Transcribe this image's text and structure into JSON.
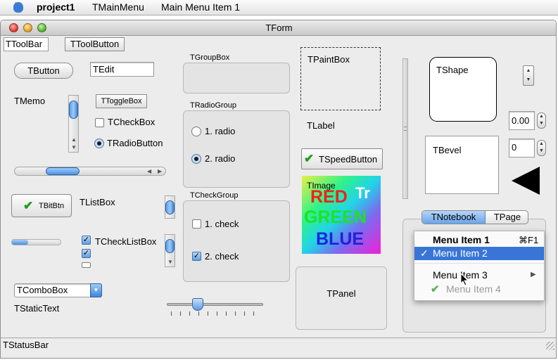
{
  "menubar": {
    "app": "project1",
    "items": [
      "TMainMenu",
      "Main Menu Item 1"
    ]
  },
  "window": {
    "title": "TForm"
  },
  "toolbar": {
    "label": "TToolBar",
    "button": "TToolButton"
  },
  "widgets": {
    "button": "TButton",
    "edit": "TEdit",
    "memo": "TMemo",
    "togglebox": "TToggleBox",
    "checkbox": "TCheckBox",
    "radiobutton": "TRadioButton",
    "bitbtn": "TBitBtn",
    "listbox": "TListBox",
    "checklistbox": "TCheckListBox",
    "combobox": "TComboBox",
    "statictext": "TStaticText",
    "groupbox": "TGroupBox",
    "radiogroup": {
      "caption": "TRadioGroup",
      "items": [
        "1. radio",
        "2. radio"
      ],
      "selected_index": 1
    },
    "checkgroup": {
      "caption": "TCheckGroup",
      "items": [
        "1. check",
        "2. check"
      ],
      "checked": [
        false,
        true
      ]
    },
    "paintbox": "TPaintBox",
    "label": "TLabel",
    "speedbutton": "TSpeedButton",
    "image": {
      "caption": "TImage",
      "red": "RED",
      "green": "GREEN",
      "blue": "BLUE",
      "logo": "Tr"
    },
    "panel": "TPanel",
    "shape": "TShape",
    "bevel": "TBevel",
    "spin_float": "0.00",
    "spin_int": "0",
    "notebook": {
      "tabs": [
        "TNotebook",
        "TPage"
      ],
      "active_tab": 0
    },
    "statusbar": "TStatusBar"
  },
  "popup_menu": {
    "items": [
      {
        "label": "Menu Item 1",
        "shortcut": "⌘F1",
        "bold": true
      },
      {
        "label": "Menu Item 2",
        "checked": true,
        "highlighted": true
      },
      {
        "label": "Menu Item 3",
        "submenu": true
      },
      {
        "label": "Menu Item 4",
        "disabled": true
      }
    ]
  },
  "colors": {
    "highlight": "#3875d7",
    "tab_active": "#7fb2ee"
  }
}
